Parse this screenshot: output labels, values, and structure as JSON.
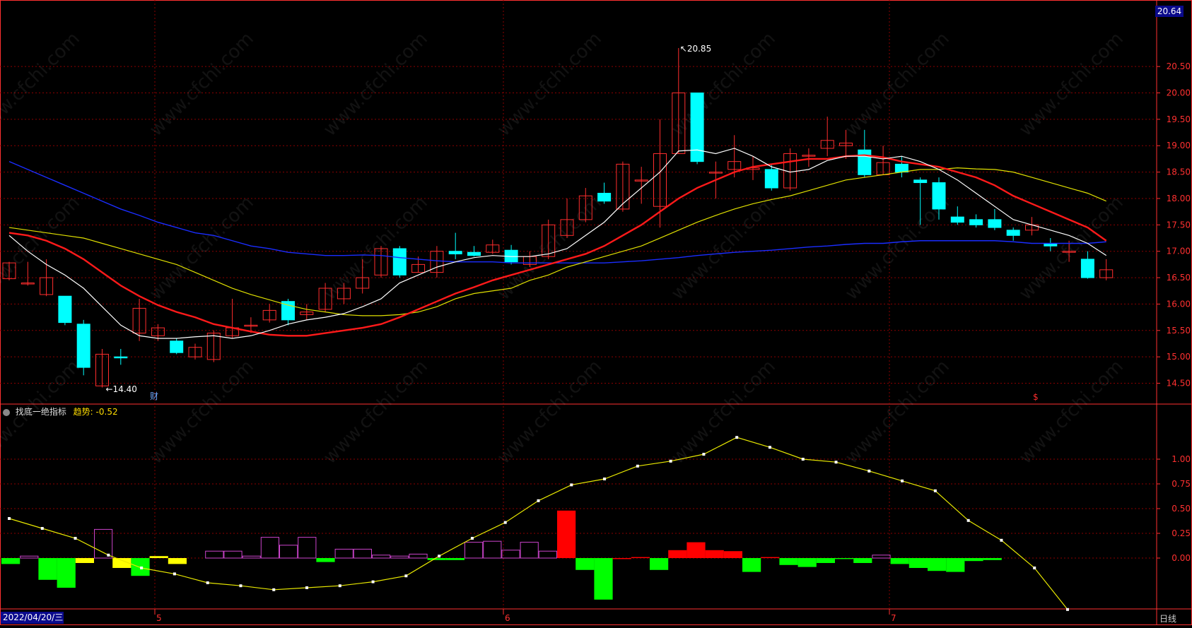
{
  "header": {
    "price_badge": "20.64",
    "date_badge": "2022/04/20/三",
    "period": "日线"
  },
  "indicator": {
    "name": "找底一绝指标",
    "trend_label": "趋势:",
    "trend_value": "-0.52"
  },
  "markers": {
    "fin": "财",
    "dollar": "$"
  },
  "annotations": {
    "high": "20.85",
    "low": "14.40"
  },
  "watermark": "www.cfchi.com",
  "colors": {
    "up": "#ff2d2d",
    "down": "#00ffff",
    "ma5": "#ffffff",
    "ma10": "#ff1a1a",
    "ma20": "#e0e000",
    "ma60": "#1a2dff",
    "grid": "#8b0000",
    "axis": "#ff3030",
    "pos_bar": "#ff0000",
    "neg_bar": "#00ff00",
    "yellow_bar": "#ffff00",
    "purple_bar": "#cc44cc"
  },
  "chart_data": [
    {
      "type": "candlestick",
      "x_ticks": [
        "5",
        "6",
        "7"
      ],
      "y_ticks": [
        "14.50",
        "15.00",
        "15.50",
        "16.00",
        "16.50",
        "17.00",
        "17.50",
        "18.00",
        "18.50",
        "19.00",
        "19.50",
        "20.00",
        "20.50"
      ],
      "ylim": [
        14.0,
        20.85
      ],
      "candles": [
        [
          16.48,
          16.78,
          16.45,
          16.8
        ],
        [
          16.4,
          16.4,
          16.35,
          16.8
        ],
        [
          16.18,
          16.5,
          16.15,
          16.85
        ],
        [
          16.15,
          15.65,
          15.6,
          16.15
        ],
        [
          15.62,
          14.8,
          14.65,
          15.7
        ],
        [
          14.45,
          15.05,
          14.42,
          15.15
        ],
        [
          15.0,
          14.98,
          14.85,
          15.15
        ],
        [
          15.45,
          15.92,
          15.3,
          16.1
        ],
        [
          15.4,
          15.55,
          15.3,
          15.62
        ],
        [
          15.3,
          15.08,
          15.05,
          15.35
        ],
        [
          15.0,
          15.18,
          14.95,
          15.25
        ],
        [
          14.95,
          15.45,
          14.9,
          15.5
        ],
        [
          15.4,
          15.55,
          15.35,
          16.1
        ],
        [
          15.6,
          15.6,
          15.45,
          15.75
        ],
        [
          15.7,
          15.88,
          15.65,
          16.0
        ],
        [
          16.05,
          15.7,
          15.6,
          16.1
        ],
        [
          15.8,
          15.85,
          15.7,
          16.0
        ],
        [
          15.9,
          16.3,
          15.85,
          16.4
        ],
        [
          16.1,
          16.3,
          16.0,
          16.4
        ],
        [
          16.3,
          16.5,
          16.2,
          16.85
        ],
        [
          16.55,
          17.05,
          16.5,
          17.1
        ],
        [
          17.05,
          16.55,
          16.5,
          17.1
        ],
        [
          16.6,
          16.75,
          16.6,
          16.9
        ],
        [
          16.6,
          17.0,
          16.5,
          17.1
        ],
        [
          17.0,
          16.95,
          16.85,
          17.35
        ],
        [
          16.98,
          16.92,
          16.9,
          17.1
        ],
        [
          16.98,
          17.12,
          16.95,
          17.22
        ],
        [
          17.02,
          16.8,
          16.75,
          17.12
        ],
        [
          16.75,
          16.9,
          16.7,
          17.0
        ],
        [
          16.9,
          17.5,
          16.85,
          17.6
        ],
        [
          17.3,
          17.6,
          17.25,
          18.0
        ],
        [
          17.6,
          18.05,
          17.55,
          18.2
        ],
        [
          18.1,
          17.95,
          17.9,
          18.3
        ],
        [
          17.8,
          18.65,
          17.75,
          18.7
        ],
        [
          18.35,
          18.35,
          17.9,
          18.6
        ],
        [
          17.85,
          18.85,
          17.45,
          19.5
        ],
        [
          18.85,
          20.0,
          18.85,
          20.85
        ],
        [
          20.0,
          18.7,
          18.65,
          20.0
        ],
        [
          18.5,
          18.5,
          18.0,
          18.7
        ],
        [
          18.55,
          18.7,
          18.4,
          19.2
        ],
        [
          18.55,
          18.58,
          18.35,
          18.8
        ],
        [
          18.55,
          18.2,
          18.15,
          18.65
        ],
        [
          18.2,
          18.85,
          18.15,
          18.95
        ],
        [
          18.8,
          18.82,
          18.6,
          18.95
        ],
        [
          18.95,
          19.1,
          18.8,
          19.55
        ],
        [
          19.0,
          19.05,
          18.75,
          19.3
        ],
        [
          18.92,
          18.45,
          18.4,
          19.3
        ],
        [
          18.45,
          18.68,
          18.45,
          19.0
        ],
        [
          18.65,
          18.5,
          18.4,
          18.8
        ],
        [
          18.35,
          18.3,
          17.5,
          18.4
        ],
        [
          18.3,
          17.8,
          17.6,
          18.4
        ],
        [
          17.65,
          17.55,
          17.5,
          17.85
        ],
        [
          17.6,
          17.5,
          17.45,
          17.7
        ],
        [
          17.6,
          17.45,
          17.4,
          17.8
        ],
        [
          17.4,
          17.3,
          17.2,
          17.45
        ],
        [
          17.4,
          17.5,
          17.3,
          17.65
        ],
        [
          17.15,
          17.1,
          17.0,
          17.25
        ],
        [
          17.0,
          17.0,
          16.8,
          17.2
        ],
        [
          16.85,
          16.5,
          16.48,
          17.0
        ],
        [
          16.5,
          16.65,
          16.45,
          16.85
        ]
      ],
      "ma5": [
        17.3,
        17.0,
        16.75,
        16.55,
        16.3,
        15.95,
        15.6,
        15.4,
        15.35,
        15.35,
        15.38,
        15.4,
        15.35,
        15.4,
        15.5,
        15.62,
        15.7,
        15.75,
        15.82,
        15.95,
        16.1,
        16.4,
        16.55,
        16.7,
        16.8,
        16.88,
        16.92,
        16.9,
        16.9,
        16.95,
        17.05,
        17.3,
        17.55,
        17.9,
        18.2,
        18.5,
        18.9,
        18.92,
        18.85,
        18.95,
        18.8,
        18.6,
        18.5,
        18.55,
        18.72,
        18.8,
        18.8,
        18.75,
        18.8,
        18.7,
        18.55,
        18.35,
        18.1,
        17.85,
        17.6,
        17.5,
        17.4,
        17.3,
        17.15,
        16.92
      ],
      "ma10": [
        17.35,
        17.3,
        17.2,
        17.05,
        16.85,
        16.6,
        16.35,
        16.15,
        15.98,
        15.85,
        15.75,
        15.62,
        15.55,
        15.48,
        15.42,
        15.4,
        15.4,
        15.45,
        15.5,
        15.55,
        15.62,
        15.75,
        15.9,
        16.05,
        16.2,
        16.32,
        16.45,
        16.55,
        16.65,
        16.75,
        16.85,
        16.95,
        17.1,
        17.3,
        17.5,
        17.75,
        18.0,
        18.2,
        18.35,
        18.5,
        18.6,
        18.65,
        18.7,
        18.75,
        18.75,
        18.8,
        18.82,
        18.78,
        18.7,
        18.65,
        18.6,
        18.5,
        18.4,
        18.25,
        18.05,
        17.9,
        17.75,
        17.6,
        17.45,
        17.2
      ],
      "ma20": [
        17.45,
        17.4,
        17.35,
        17.3,
        17.25,
        17.15,
        17.05,
        16.95,
        16.85,
        16.75,
        16.6,
        16.45,
        16.3,
        16.18,
        16.08,
        15.98,
        15.9,
        15.85,
        15.8,
        15.78,
        15.78,
        15.8,
        15.85,
        15.95,
        16.1,
        16.2,
        16.25,
        16.3,
        16.45,
        16.55,
        16.7,
        16.8,
        16.9,
        17.0,
        17.1,
        17.25,
        17.4,
        17.55,
        17.68,
        17.8,
        17.9,
        17.98,
        18.05,
        18.15,
        18.25,
        18.35,
        18.4,
        18.45,
        18.5,
        18.55,
        18.55,
        18.58,
        18.56,
        18.55,
        18.5,
        18.4,
        18.3,
        18.2,
        18.1,
        17.95
      ],
      "ma60": [
        18.7,
        18.55,
        18.4,
        18.25,
        18.1,
        17.95,
        17.8,
        17.68,
        17.55,
        17.45,
        17.35,
        17.3,
        17.2,
        17.1,
        17.05,
        16.98,
        16.95,
        16.92,
        16.92,
        16.93,
        16.92,
        16.88,
        16.85,
        16.82,
        16.8,
        16.8,
        16.8,
        16.78,
        16.78,
        16.78,
        16.78,
        16.78,
        16.78,
        16.8,
        16.82,
        16.85,
        16.88,
        16.92,
        16.95,
        16.98,
        17.0,
        17.02,
        17.05,
        17.08,
        17.1,
        17.13,
        17.15,
        17.15,
        17.18,
        17.2,
        17.2,
        17.2,
        17.2,
        17.2,
        17.18,
        17.15,
        17.15,
        17.15,
        17.15,
        17.18
      ]
    },
    {
      "type": "bar",
      "name": "找底一绝指标",
      "y_ticks": [
        "0.00",
        "0.25",
        "0.50",
        "0.75",
        "1.00"
      ],
      "ylim": [
        -0.52,
        1.45
      ],
      "bars": [
        -0.06,
        0.02,
        -0.22,
        -0.3,
        -0.05,
        0.29,
        -0.1,
        -0.18,
        0.02,
        -0.06,
        -0.1,
        0.07,
        0.07,
        0.02,
        0.21,
        0.13,
        0.21,
        -0.04,
        0.09,
        0.09,
        0.03,
        0.02,
        0.04,
        -0.02,
        -0.02,
        0.16,
        0.17,
        0.08,
        0.16,
        0.07,
        0.48,
        -0.12,
        -0.42,
        -0.01,
        0.01,
        -0.12,
        0.08,
        0.16,
        0.08,
        0.07,
        -0.14,
        0.01,
        -0.07,
        -0.09,
        -0.05,
        -0.01,
        -0.05,
        0.03,
        -0.06,
        -0.1,
        -0.13,
        -0.14,
        -0.03,
        -0.02
      ],
      "bar_colors": [
        "g",
        "p",
        "g",
        "g",
        "y",
        "p",
        "y",
        "g",
        "y",
        "y",
        "n",
        "p",
        "p",
        "p",
        "p",
        "p",
        "p",
        "g",
        "p",
        "p",
        "p",
        "p",
        "p",
        "g",
        "g",
        "p",
        "p",
        "p",
        "p",
        "p",
        "r",
        "g",
        "g",
        "r",
        "r",
        "g",
        "r",
        "r",
        "r",
        "r",
        "g",
        "r",
        "g",
        "g",
        "g",
        "g",
        "g",
        "p",
        "g",
        "g",
        "g",
        "g",
        "g",
        "g"
      ],
      "trend": [
        0.4,
        0.3,
        0.2,
        0.03,
        -0.1,
        -0.16,
        -0.25,
        -0.28,
        -0.32,
        -0.3,
        -0.28,
        -0.24,
        -0.18,
        0.02,
        0.2,
        0.36,
        0.58,
        0.74,
        0.8,
        0.93,
        0.98,
        1.05,
        1.22,
        1.12,
        1.0,
        0.97,
        0.88,
        0.78,
        0.68,
        0.38,
        0.18,
        -0.1,
        -0.52
      ]
    }
  ]
}
